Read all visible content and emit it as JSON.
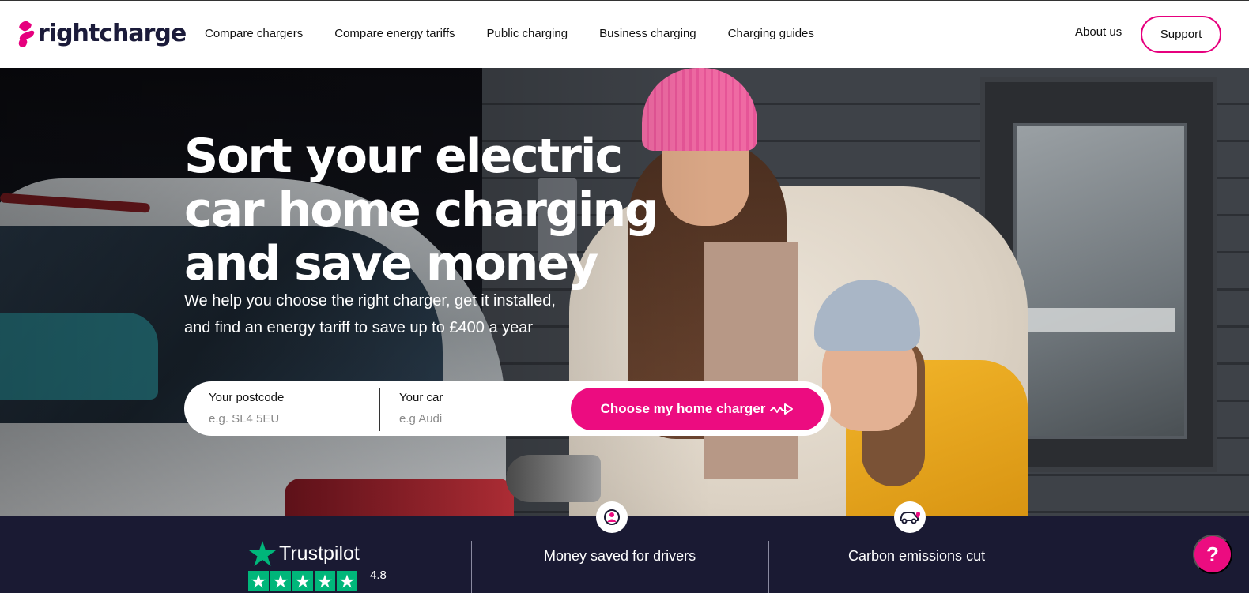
{
  "brand": {
    "name": "rightcharge",
    "accent": "#ec0c80",
    "dark": "#1a1a33"
  },
  "nav": {
    "items": [
      {
        "label": "Compare chargers"
      },
      {
        "label": "Compare energy tariffs"
      },
      {
        "label": "Public charging"
      },
      {
        "label": "Business charging"
      },
      {
        "label": "Charging guides"
      }
    ],
    "about": "About us",
    "support": "Support"
  },
  "hero": {
    "title": "Sort your electric car home charging and save money",
    "subtitle_line1": "We help you choose the right charger, get it installed,",
    "subtitle_line2": "and find an energy tariff to save up to £400 a year"
  },
  "search": {
    "postcode_label": "Your postcode",
    "postcode_placeholder": "e.g. SL4 5EU",
    "car_label": "Your car",
    "car_placeholder": "e.g Audi",
    "cta_label": "Choose my home charger",
    "cta_icon": "plug-arrow-icon"
  },
  "stats": {
    "trustpilot": {
      "name": "Trustpilot",
      "rating": "4.8",
      "stars": 5
    },
    "money": {
      "label": "Money saved for drivers",
      "icon": "driver-person-icon"
    },
    "carbon": {
      "label": "Carbon emissions cut",
      "icon": "car-heart-icon"
    }
  },
  "help": {
    "label": "?"
  }
}
